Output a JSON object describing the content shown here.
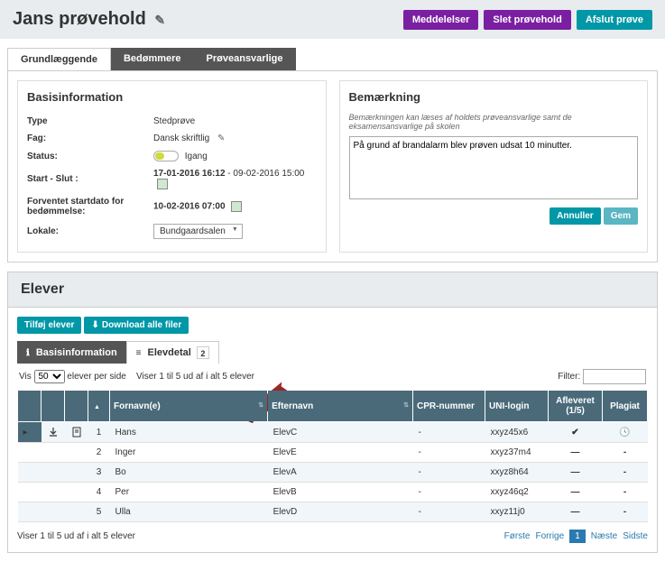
{
  "header": {
    "title": "Jans prøvehold",
    "buttons": {
      "notifications": "Meddelelser",
      "delete": "Slet prøvehold",
      "finish": "Afslut prøve"
    }
  },
  "top_tabs": {
    "t1": "Grundlæggende",
    "t2": "Bedømmere",
    "t3": "Prøveansvarlige"
  },
  "basic_info": {
    "title": "Basisinformation",
    "type_label": "Type",
    "type_value": "Stedprøve",
    "fag_label": "Fag:",
    "fag_value": "Dansk skriftlig",
    "status_label": "Status:",
    "status_value": "Igang",
    "start_slut_label": "Start - Slut :",
    "start_value": "17-01-2016 16:12",
    "slut_value": "09-02-2016 15:00",
    "forventet_label": "Forventet startdato for bedømmelse:",
    "forventet_value": "10-02-2016 07:00",
    "lokale_label": "Lokale:",
    "lokale_value": "Bundgaardsalen"
  },
  "bemaerkning": {
    "title": "Bemærkning",
    "desc": "Bemærkningen kan læses af holdets prøveansvarlige samt de eksamensansvarlige på skolen",
    "text": "På grund af brandalarm blev prøven udsat 10 minutter.",
    "cancel": "Annuller",
    "save": "Gem"
  },
  "elever": {
    "title": "Elever",
    "add_btn": "Tilføj elever",
    "download_btn": "Download alle filer",
    "sub_tab1": "Basisinformation",
    "sub_tab2": "Elevdetal",
    "sub_tab2_badge": "2",
    "vis_label": "Vis",
    "per_side": "50",
    "per_side_suffix": "elever per side",
    "result_text": "Viser 1 til 5 ud af i alt 5 elever",
    "filter_label": "Filter:",
    "filter_value": "",
    "cols": {
      "fornavn": "Fornavn(e)",
      "efternavn": "Efternavn",
      "cpr": "CPR-nummer",
      "uni": "UNI-login",
      "afleveret": "Afleveret (1/5)",
      "plagiat": "Plagiat"
    },
    "rows": [
      {
        "idx": "1",
        "fornavn": "Hans",
        "efternavn": "ElevC",
        "cpr": "-",
        "uni": "xxyz45x6",
        "afleveret": "✔",
        "plagiat": "clock"
      },
      {
        "idx": "2",
        "fornavn": "Inger",
        "efternavn": "ElevE",
        "cpr": "-",
        "uni": "xxyz37m4",
        "afleveret": "—",
        "plagiat": "-"
      },
      {
        "idx": "3",
        "fornavn": "Bo",
        "efternavn": "ElevA",
        "cpr": "-",
        "uni": "xxyz8h64",
        "afleveret": "—",
        "plagiat": "-"
      },
      {
        "idx": "4",
        "fornavn": "Per",
        "efternavn": "ElevB",
        "cpr": "-",
        "uni": "xxyz46q2",
        "afleveret": "—",
        "plagiat": "-"
      },
      {
        "idx": "5",
        "fornavn": "Ulla",
        "efternavn": "ElevD",
        "cpr": "-",
        "uni": "xxyz11j0",
        "afleveret": "—",
        "plagiat": "-"
      }
    ],
    "footer_text": "Viser 1 til 5 ud af i alt 5 elever",
    "pagination": {
      "first": "Første",
      "prev": "Forrige",
      "current": "1",
      "next": "Næste",
      "last": "Sidste"
    }
  }
}
